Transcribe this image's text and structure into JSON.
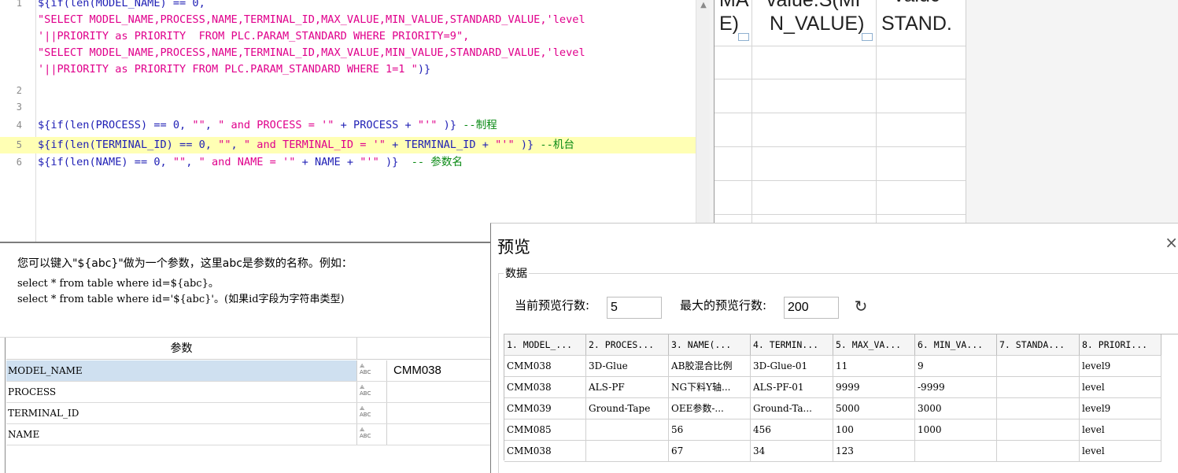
{
  "editor": {
    "lines": [
      {
        "n": "1",
        "parts": [
          {
            "t": "${if(len(MODEL_NAME) == 0,",
            "c": "op"
          }
        ]
      },
      {
        "n": "",
        "parts": [
          {
            "t": "\"SELECT MODEL_NAME,PROCESS,NAME,TERMINAL_ID,MAX_VALUE,MIN_VALUE,STANDARD_VALUE,'level",
            "c": "str"
          }
        ]
      },
      {
        "n": "",
        "parts": [
          {
            "t": "'||PRIORITY as PRIORITY  FROM PLC.PARAM_STANDARD WHERE PRIORITY=9\",",
            "c": "str"
          }
        ]
      },
      {
        "n": "",
        "parts": [
          {
            "t": "\"SELECT MODEL_NAME,PROCESS,NAME,TERMINAL_ID,MAX_VALUE,MIN_VALUE,STANDARD_VALUE,'level",
            "c": "str"
          }
        ]
      },
      {
        "n": "",
        "parts": [
          {
            "t": "'||PRIORITY as PRIORITY FROM PLC.PARAM_STANDARD WHERE 1=1 \"",
            "c": "str"
          },
          {
            "t": ")}",
            "c": "op"
          }
        ]
      },
      {
        "n": "2",
        "parts": []
      },
      {
        "n": "3",
        "parts": []
      },
      {
        "n": "4",
        "parts": [
          {
            "t": "${if(len(PROCESS) == 0, ",
            "c": "op"
          },
          {
            "t": "\"\"",
            "c": "str"
          },
          {
            "t": ", ",
            "c": "op"
          },
          {
            "t": "\" and PROCESS = '\"",
            "c": "str"
          },
          {
            "t": " + PROCESS + ",
            "c": "op"
          },
          {
            "t": "\"'\"",
            "c": "str"
          },
          {
            "t": " )} ",
            "c": "op"
          },
          {
            "t": "--制程",
            "c": "cmt"
          }
        ]
      },
      {
        "n": "5",
        "hl": true,
        "parts": [
          {
            "t": "${if(len(TERMINAL_ID) == 0, ",
            "c": "op"
          },
          {
            "t": "\"\"",
            "c": "str"
          },
          {
            "t": ", ",
            "c": "op"
          },
          {
            "t": "\" and TERMINAL_ID = '\"",
            "c": "str"
          },
          {
            "t": " + TERMINAL_ID + ",
            "c": "op"
          },
          {
            "t": "\"'\"",
            "c": "str"
          },
          {
            "t": " )} ",
            "c": "op"
          },
          {
            "t": "--机台",
            "c": "cmt"
          }
        ]
      },
      {
        "n": "6",
        "parts": [
          {
            "t": "${if(len(NAME) == 0, ",
            "c": "op"
          },
          {
            "t": "\"\"",
            "c": "str"
          },
          {
            "t": ", ",
            "c": "op"
          },
          {
            "t": "\" and NAME = '\"",
            "c": "str"
          },
          {
            "t": " + NAME + ",
            "c": "op"
          },
          {
            "t": "\"'\"",
            "c": "str"
          },
          {
            "t": " )}  ",
            "c": "op"
          },
          {
            "t": "-- 参数名",
            "c": "cmt"
          }
        ]
      }
    ]
  },
  "bg_grid": {
    "headers": [
      {
        "text": "MA",
        "sub": "E)"
      },
      {
        "text": "value.S(MI",
        "sub": "N_VALUE)"
      },
      {
        "text": "valuc",
        "sub": "STAND."
      }
    ]
  },
  "hint": {
    "line1": "您可以键入\"${abc}\"做为一个参数，这里abc是参数的名称。例如：",
    "line2": "select * from table where id=${abc}。",
    "line3": "select * from table where id='${abc}'。(如果id字段为字符串类型)"
  },
  "params": {
    "header": "参数",
    "type_icon": "ABC-type-icon",
    "rows": [
      {
        "name": "MODEL_NAME",
        "value": "CMM038",
        "selected": true
      },
      {
        "name": "PROCESS",
        "value": ""
      },
      {
        "name": "TERMINAL_ID",
        "value": ""
      },
      {
        "name": "NAME",
        "value": ""
      }
    ]
  },
  "preview": {
    "title": "预览",
    "close": "×",
    "group_label": "数据",
    "current_rows_label": "当前预览行数:",
    "current_rows_value": "5",
    "max_rows_label": "最大的预览行数:",
    "max_rows_value": "200",
    "refresh_icon": "refresh-icon",
    "columns": [
      "1. MODEL_...",
      "2. PROCES...",
      "3. NAME(...",
      "4. TERMIN...",
      "5. MAX_VA...",
      "6. MIN_VA...",
      "7. STANDA...",
      "8. PRIORI..."
    ],
    "rows": [
      [
        "CMM038",
        "3D-Glue",
        "AB胶混合比例",
        "3D-Glue-01",
        "11",
        "9",
        "",
        "level9"
      ],
      [
        "CMM038",
        "ALS-PF",
        "NG下料Y轴...",
        "ALS-PF-01",
        "9999",
        "-9999",
        "",
        "level"
      ],
      [
        "CMM039",
        "Ground-Tape",
        "OEE参数-...",
        "Ground-Ta...",
        "5000",
        "3000",
        "",
        "level9"
      ],
      [
        "CMM085",
        "",
        "56",
        "456",
        "100",
        "1000",
        "",
        "level"
      ],
      [
        "CMM038",
        "",
        "67",
        "34",
        "123",
        "",
        "",
        "level"
      ]
    ]
  }
}
